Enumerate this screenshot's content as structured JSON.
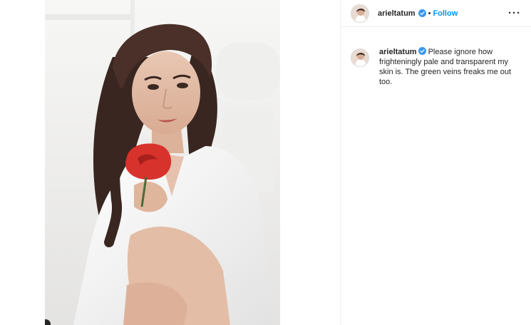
{
  "post": {
    "author": {
      "username": "arieltatum",
      "verified": true
    },
    "header": {
      "separator": "•",
      "follow_label": "Follow",
      "more_label": "···"
    },
    "caption": {
      "username": "arieltatum",
      "text": "Please ignore how frighteningly pale and transparent my skin is. The green veins freaks me out too."
    }
  },
  "colors": {
    "accent": "#0095f6",
    "text": "#262626",
    "border": "#efefef",
    "rose": "#d8322c"
  },
  "icons": {
    "verified": "verified-badge-icon",
    "more": "more-options-icon"
  }
}
